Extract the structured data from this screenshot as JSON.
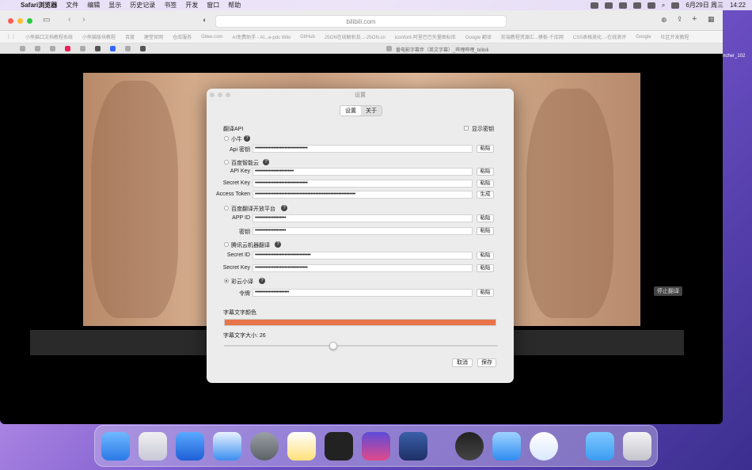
{
  "menubar": {
    "app": "Safari浏览器",
    "items": [
      "文件",
      "编辑",
      "显示",
      "历史记录",
      "书签",
      "开发",
      "窗口",
      "帮助"
    ],
    "date": "6月29日 周三",
    "time": "14:22"
  },
  "browser": {
    "url": "bilibili.com",
    "tab_title": "番电影字幕伴（英文字幕）_哔哩哔哩_bilibili",
    "bookmarks": [
      "小熊猫口文档教程系统",
      "小熊猫版块教程",
      "百度",
      "建堂官网",
      "仓库服务",
      "Gitee.com",
      "AI免费助手 - AI...e-pdc Wiki",
      "GitHub",
      "JSON在线解析及...-JSON.cn",
      "iconfont-阿里巴巴矢量图标库",
      "Google 翻译",
      "前端教程资源汇...模板-千库网",
      "CSS表格美化...-在线测评",
      "Google",
      "社区开发教程"
    ],
    "side_text": "ncher_102",
    "stop_label": "停止翻译"
  },
  "dialog": {
    "title": "设置",
    "tabs": [
      "设置",
      "关于"
    ],
    "api_section": "翻译API",
    "show_key": "显示密钥",
    "providers": {
      "xiaoniu": {
        "name": "小牛",
        "api_key_label": "Api 密钥",
        "api_key": "••••••••••••••••••••••••••••••••••"
      },
      "baidu_cloud": {
        "name": "百度智能云",
        "api_key_label": "API Key",
        "api_key": "•••••••••••••••••••••••••",
        "secret_label": "Secret Key",
        "secret": "••••••••••••••••••••••••••••••••••",
        "token_label": "Access Token",
        "token": "•••••••••••••••••••••••••••••••••••••••••••••••••••••••••••••••••"
      },
      "baidu_fanyi": {
        "name": "百度翻译开放平台",
        "appid_label": "APP ID",
        "appid": "••••••••••••••••••••",
        "key_label": "密钥",
        "key": "••••••••••••••••••••"
      },
      "tencent": {
        "name": "腾讯云机器翻译",
        "secretid_label": "Secret ID",
        "secretid": "••••••••••••••••••••••••••••••••••••",
        "secretkey_label": "Secret Key",
        "secretkey": "••••••••••••••••••••••••••••••••••"
      },
      "caiyun": {
        "name": "彩云小译",
        "token_label": "令牌",
        "token": "••••••••••••••••••••••"
      }
    },
    "paste": "粘贴",
    "generate": "生成",
    "color_label": "字幕文字颜色",
    "subtitle_color": "#e8754a",
    "size_label": "字幕文字大小: 26",
    "font_size": 26,
    "cancel": "取消",
    "save": "保存"
  }
}
